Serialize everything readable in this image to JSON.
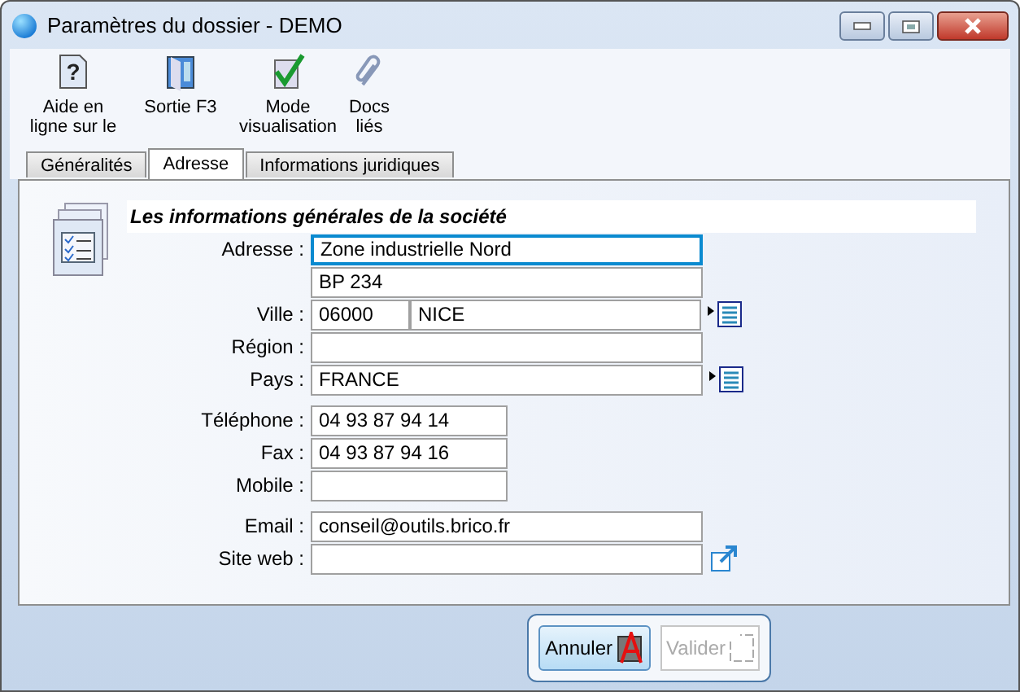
{
  "window": {
    "title": "Paramètres du dossier - DEMO"
  },
  "toolbar": [
    {
      "kind": "help",
      "glyph": "?",
      "label": "Aide en ligne sur le"
    },
    {
      "kind": "exit",
      "label": "Sortie F3"
    },
    {
      "kind": "view",
      "label": "Mode visualisation"
    },
    {
      "kind": "docs",
      "label": "Docs liés"
    }
  ],
  "tabs": [
    {
      "label": "Généralités",
      "selected": false
    },
    {
      "label": "Adresse",
      "selected": true
    },
    {
      "label": "Informations juridiques",
      "selected": false
    }
  ],
  "section": {
    "title": "Les informations générales de la société"
  },
  "field_groups": [
    [
      {
        "kind": "wide",
        "label": "Adresse :",
        "value": "Zone industrielle Nord",
        "focused": true
      },
      {
        "kind": "wide",
        "value": "BP 234",
        "focused": false
      },
      {
        "kind": "zipcity",
        "label": "Ville :",
        "zip": "06000",
        "city": "NICE",
        "list_button": true
      },
      {
        "kind": "wide",
        "label": "Région :",
        "focused": false
      },
      {
        "kind": "wide",
        "label": "Pays :",
        "value": "FRANCE",
        "focused": false,
        "list_button": true
      }
    ],
    [
      {
        "kind": "short",
        "label": "Téléphone :",
        "value": "04 93 87 94 14",
        "focused": false
      },
      {
        "kind": "short",
        "label": "Fax :",
        "value": "04 93 87 94 16",
        "focused": false
      },
      {
        "kind": "short",
        "label": "Mobile :",
        "focused": false
      }
    ],
    [
      {
        "kind": "wide",
        "label": "Email :",
        "value": "conseil@outils.brico.fr",
        "focused": false
      },
      {
        "kind": "wide",
        "label": "Site web :",
        "focused": false,
        "link_button": true
      }
    ]
  ],
  "buttons": [
    {
      "kind": "cancel",
      "label": "Annuler",
      "disabled": false
    },
    {
      "kind": "validate",
      "label": "Valider",
      "disabled": true
    }
  ]
}
